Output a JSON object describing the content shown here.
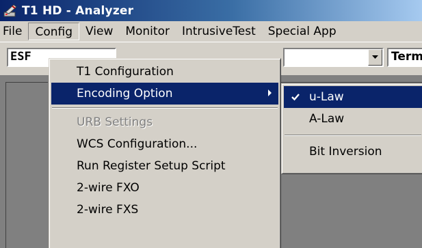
{
  "window": {
    "title": "T1 HD - Analyzer",
    "icon": "analyzer-app-icon"
  },
  "menubar": {
    "items": [
      {
        "label": "File"
      },
      {
        "label": "Config",
        "open": true
      },
      {
        "label": "View"
      },
      {
        "label": "Monitor"
      },
      {
        "label": "IntrusiveTest"
      },
      {
        "label": "Special App"
      }
    ]
  },
  "toolbar": {
    "left_combo_value": "ESF",
    "right_combo_value": "Term"
  },
  "config_menu": {
    "items": [
      {
        "label": "T1 Configuration"
      },
      {
        "label": "Encoding Option",
        "highlighted": true,
        "has_submenu": true
      },
      {
        "label": "URB Settings",
        "disabled": true
      },
      {
        "label": "WCS Configuration..."
      },
      {
        "label": "Run Register Setup Script"
      },
      {
        "label": "2-wire FXO"
      },
      {
        "label": "2-wire FXS"
      }
    ]
  },
  "encoding_submenu": {
    "items": [
      {
        "label": "u-Law",
        "checked": true,
        "highlighted": true
      },
      {
        "label": "A-Law"
      },
      {
        "label": "Bit Inversion"
      }
    ]
  },
  "colors": {
    "menu_highlight": "#0a246a",
    "title_gradient_start": "#0a246a",
    "title_gradient_end": "#a6caf0",
    "face": "#d4d0c8",
    "client_bg": "#808080"
  }
}
